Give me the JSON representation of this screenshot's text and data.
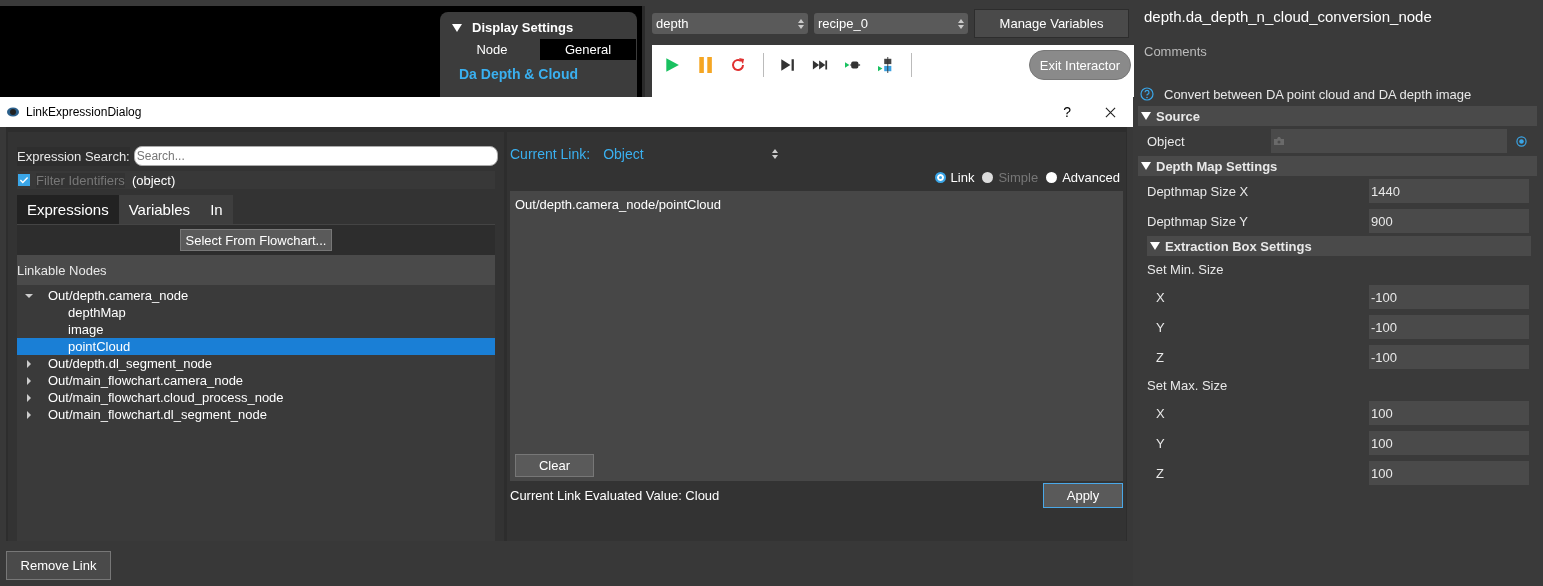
{
  "display_settings": {
    "title": "Display Settings",
    "expanded": true,
    "tabs": [
      {
        "label": "Node",
        "selected": false
      },
      {
        "label": "General",
        "selected": true
      }
    ],
    "heading": "Da Depth & Cloud"
  },
  "toolbar": {
    "selects": [
      {
        "value": "depth"
      },
      {
        "value": "recipe_0"
      }
    ],
    "manage_button": "Manage Variables",
    "exit_button": "Exit Interactor"
  },
  "properties": {
    "title": "depth.da_depth_n_cloud_conversion_node",
    "comments_label": "Comments",
    "description": "Convert between DA point cloud and DA depth image",
    "sections": [
      {
        "title": "Source",
        "expanded": true,
        "rows": [
          {
            "kind": "object",
            "label": "Object"
          }
        ]
      },
      {
        "title": "Depth Map Settings",
        "expanded": true,
        "rows": [
          {
            "kind": "field",
            "label": "Depthmap Size X",
            "value": "1440"
          },
          {
            "kind": "field",
            "label": "Depthmap Size Y",
            "value": "900"
          },
          {
            "kind": "subsection",
            "title": "Extraction Box Settings",
            "expanded": true,
            "rows": [
              {
                "kind": "heading",
                "label": "Set Min. Size"
              },
              {
                "kind": "axis",
                "label": "X",
                "value": "-100"
              },
              {
                "kind": "axis",
                "label": "Y",
                "value": "-100"
              },
              {
                "kind": "axis",
                "label": "Z",
                "value": "-100"
              },
              {
                "kind": "heading",
                "label": "Set Max. Size"
              },
              {
                "kind": "axis",
                "label": "X",
                "value": "100"
              },
              {
                "kind": "axis",
                "label": "Y",
                "value": "100"
              },
              {
                "kind": "axis",
                "label": "Z",
                "value": "100"
              }
            ]
          }
        ]
      }
    ]
  },
  "dialog": {
    "title": "LinkExpressionDialog",
    "help": "?",
    "left": {
      "search_label": "Expression Search:",
      "search_placeholder": "Search...",
      "filter": {
        "label": "Filter Identifiers",
        "checked": true,
        "disabled": true
      },
      "filter_type": "(object)",
      "tabs": [
        {
          "label": "Expressions",
          "selected": true
        },
        {
          "label": "Variables",
          "selected": false
        },
        {
          "label": "In",
          "selected": false
        }
      ],
      "select_button": "Select From Flowchart...",
      "tree_header": "Linkable Nodes",
      "tree": [
        {
          "label": "Out/depth.camera_node",
          "expanded": true,
          "selected": false,
          "children": [
            {
              "label": "depthMap",
              "selected": false
            },
            {
              "label": "image",
              "selected": false
            },
            {
              "label": "pointCloud",
              "selected": true
            }
          ]
        },
        {
          "label": "Out/depth.dl_segment_node",
          "expanded": false,
          "selected": false
        },
        {
          "label": "Out/main_flowchart.camera_node",
          "expanded": false,
          "selected": false
        },
        {
          "label": "Out/main_flowchart.cloud_process_node",
          "expanded": false,
          "selected": false
        },
        {
          "label": "Out/main_flowchart.dl_segment_node",
          "expanded": false,
          "selected": false
        }
      ]
    },
    "right": {
      "current_link_label": "Current Link:",
      "current_link_value": "Object",
      "modes": [
        {
          "label": "Link",
          "selected": true,
          "disabled": false
        },
        {
          "label": "Simple",
          "selected": false,
          "disabled": true
        },
        {
          "label": "Advanced",
          "selected": false,
          "disabled": false
        }
      ],
      "expression": "Out/depth.camera_node/pointCloud",
      "clear_button": "Clear",
      "evaluated": "Current Link Evaluated Value: Cloud",
      "apply_button": "Apply"
    },
    "remove_button": "Remove Link"
  }
}
